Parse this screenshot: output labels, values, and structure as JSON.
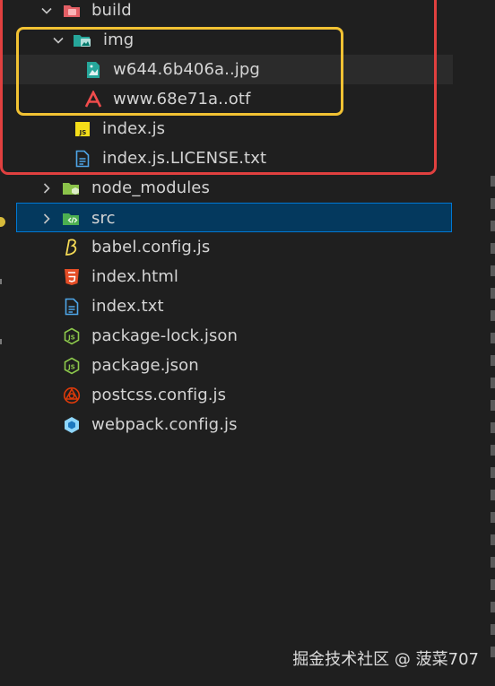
{
  "tree": {
    "build": {
      "label": "build"
    },
    "img": {
      "label": "img"
    },
    "img_files": [
      {
        "label": "w644.6b406a..jpg"
      },
      {
        "label": "www.68e71a..otf"
      }
    ],
    "build_files": [
      {
        "label": "index.js",
        "badge": "JS"
      },
      {
        "label": "index.js.LICENSE.txt"
      }
    ],
    "node_modules": {
      "label": "node_modules"
    },
    "src": {
      "label": "src"
    },
    "root_files": [
      {
        "label": "babel.config.js"
      },
      {
        "label": "index.html"
      },
      {
        "label": "index.txt"
      },
      {
        "label": "package-lock.json"
      },
      {
        "label": "package.json"
      },
      {
        "label": "postcss.config.js"
      },
      {
        "label": "webpack.config.js"
      }
    ]
  },
  "highlights": {
    "red": "#e0403f",
    "yellow": "#f2c233"
  },
  "watermark": "掘金技术社区 @ 菠菜707"
}
